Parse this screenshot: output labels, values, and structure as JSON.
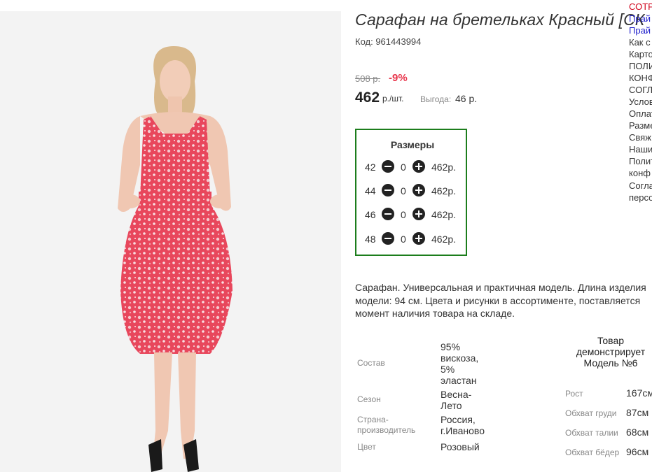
{
  "product": {
    "title": "Сарафан на бретельках Красный [СК",
    "code": "Код: 961443994",
    "old_price": "508 р.",
    "discount": "-9%",
    "price": "462",
    "price_unit": "р./шт.",
    "benefit_label": "Выгода:",
    "benefit_value": "46 р."
  },
  "sizes": {
    "title": "Размеры",
    "rows": [
      {
        "size": "42",
        "qty": "0",
        "price": "462р."
      },
      {
        "size": "44",
        "qty": "0",
        "price": "462р."
      },
      {
        "size": "46",
        "qty": "0",
        "price": "462р."
      },
      {
        "size": "48",
        "qty": "0",
        "price": "462р."
      }
    ]
  },
  "description": {
    "line1": "Сарафан. Универсальная и практичная модель. Длина изделия",
    "line2": "модели: 94 см. Цвета и рисунки в ассортименте, поставляется",
    "line3": "момент наличия товара на складе."
  },
  "attributes": [
    {
      "label_lines": [
        "Состав"
      ],
      "value_lines": [
        "95%",
        "вискоза,",
        "5%",
        "эластан"
      ]
    },
    {
      "label_lines": [
        "Сезон"
      ],
      "value_lines": [
        "Весна-",
        "Лето"
      ]
    },
    {
      "label_lines": [
        "Страна-",
        "производитель"
      ],
      "value_lines": [
        "Россия,",
        "г.Иваново"
      ]
    },
    {
      "label_lines": [
        "Цвет"
      ],
      "value_lines": [
        "Розовый"
      ]
    }
  ],
  "model": {
    "heading_lines": [
      "Товар",
      "демонстрирует",
      "Модель №6"
    ],
    "measurements": [
      {
        "label": "Рост",
        "value": "167см"
      },
      {
        "label": "Обхват груди",
        "value": "87см"
      },
      {
        "label": "Обхват талии",
        "value": "68см"
      },
      {
        "label": "Обхват бёдер",
        "value": "96см"
      }
    ]
  },
  "side_menu": [
    {
      "text": "СОТР",
      "color": "red"
    },
    {
      "text": "Прай",
      "color": "blue"
    },
    {
      "text": "Прай",
      "color": "blue"
    },
    {
      "text": "Как с",
      "color": "dark"
    },
    {
      "text": "Карто",
      "color": "dark"
    },
    {
      "text": "ПОЛИ",
      "color": "dark"
    },
    {
      "text": "КОНФ",
      "color": "dark"
    },
    {
      "text": "СОГЛ",
      "color": "dark"
    },
    {
      "text": "Услов",
      "color": "dark"
    },
    {
      "text": "Оплат",
      "color": "dark"
    },
    {
      "text": "Разме",
      "color": "dark"
    },
    {
      "text": "Свяж",
      "color": "dark"
    },
    {
      "text": "Наши",
      "color": "dark"
    },
    {
      "text": "Полит",
      "color": "dark"
    },
    {
      "text": "конф",
      "color": "dark"
    },
    {
      "text": "Согла",
      "color": "dark"
    },
    {
      "text": "персо",
      "color": "dark"
    }
  ],
  "colors": {
    "size_box_border": "#1c7d1c",
    "discount": "#e8344a",
    "dress": "#e8475c"
  }
}
